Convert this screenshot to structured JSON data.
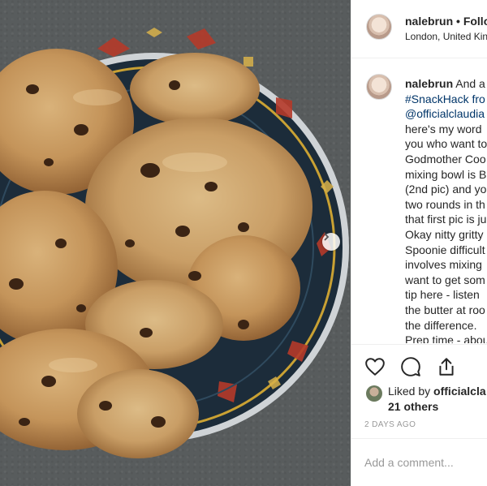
{
  "post": {
    "username": "nalebrun",
    "dot": "•",
    "follow_label": "Follo",
    "location": "London, United Kin",
    "caption_lines": [
      {
        "text": "And a",
        "type": "username-lead"
      },
      {
        "text": "#SnackHack fro",
        "type": "hashtag"
      },
      {
        "text": "@officialclaudia",
        "type": "mention"
      },
      {
        "text": "here's my word",
        "type": "text"
      },
      {
        "text": "you who want to",
        "type": "text"
      },
      {
        "text": "Godmother Coo",
        "type": "text"
      },
      {
        "text": "mixing bowl is B",
        "type": "text"
      },
      {
        "text": "(2nd pic) and yo",
        "type": "text"
      },
      {
        "text": "two rounds in th",
        "type": "text"
      },
      {
        "text": "that first pic is ju",
        "type": "text"
      },
      {
        "text": "Okay nitty gritty",
        "type": "text"
      },
      {
        "text": "Spoonie difficult",
        "type": "text"
      },
      {
        "text": "involves mixing",
        "type": "text"
      },
      {
        "text": "want to get som",
        "type": "text"
      },
      {
        "text": "tip here - listen",
        "type": "text"
      },
      {
        "text": "the butter at roo",
        "type": "text"
      },
      {
        "text": "the difference.",
        "type": "text"
      },
      {
        "text": "Prep time - abou",
        "type": "text"
      }
    ],
    "likes": {
      "prefix": "Liked by ",
      "liker": "officialcla",
      "others": "21 others"
    },
    "timestamp": "2 DAYS AGO",
    "comment_placeholder": "Add a comment..."
  },
  "icons": {
    "like": "heart-icon",
    "comment": "comment-bubble-icon",
    "share": "share-icon",
    "next": "chevron-right-icon"
  },
  "colors": {
    "link": "#003569",
    "text": "#262626",
    "muted": "#999999",
    "divider": "#efefef"
  }
}
